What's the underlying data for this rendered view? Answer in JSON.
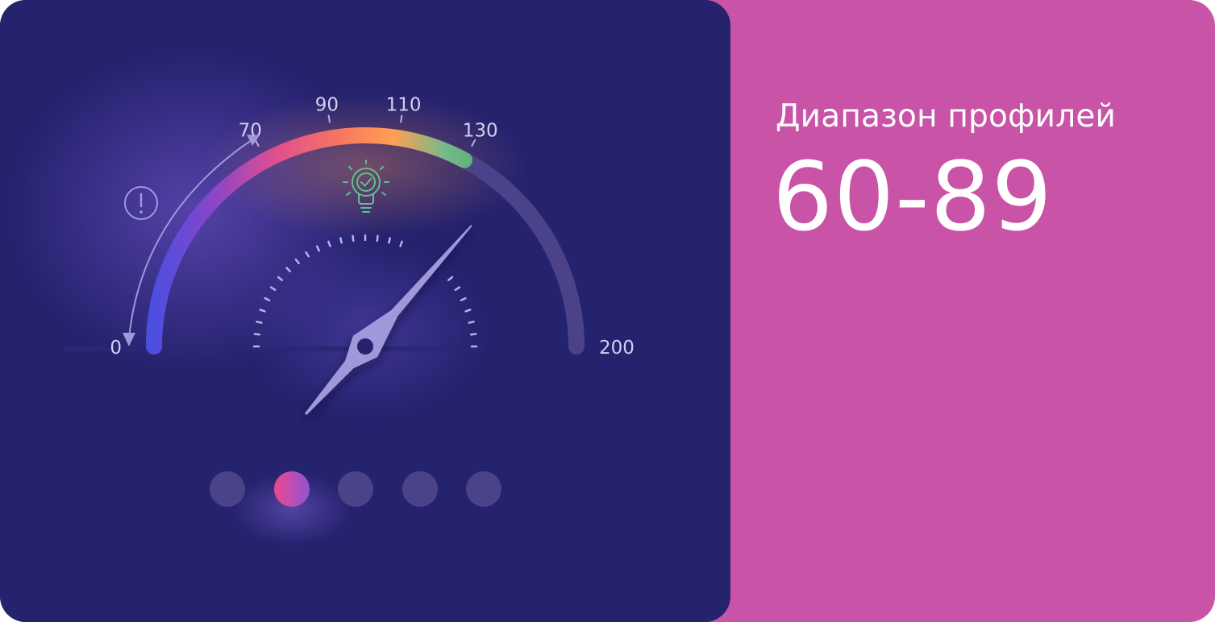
{
  "colors": {
    "panel_bg": "#25226E",
    "accent_bg": "#C953A7",
    "track": "#4B4389",
    "needle": "#9F98DB",
    "tick_light": "#B7B2E8",
    "label": "#D2CFF0",
    "dot_inactive": "#4B4389",
    "icon_green": "#5EC28B"
  },
  "gauge": {
    "scale_min": 0,
    "scale_max": 200,
    "labels": [
      "0",
      "70",
      "90",
      "110",
      "130",
      "200"
    ],
    "highlighted_range": [
      0,
      130
    ],
    "needle_value": 145
  },
  "info": {
    "title": "Диапазон профилей",
    "range": "60-89"
  },
  "pagination": {
    "count": 5,
    "active_index": 1
  },
  "icons": {
    "warning": "exclamation-circle-icon",
    "idea": "lightbulb-check-icon"
  }
}
